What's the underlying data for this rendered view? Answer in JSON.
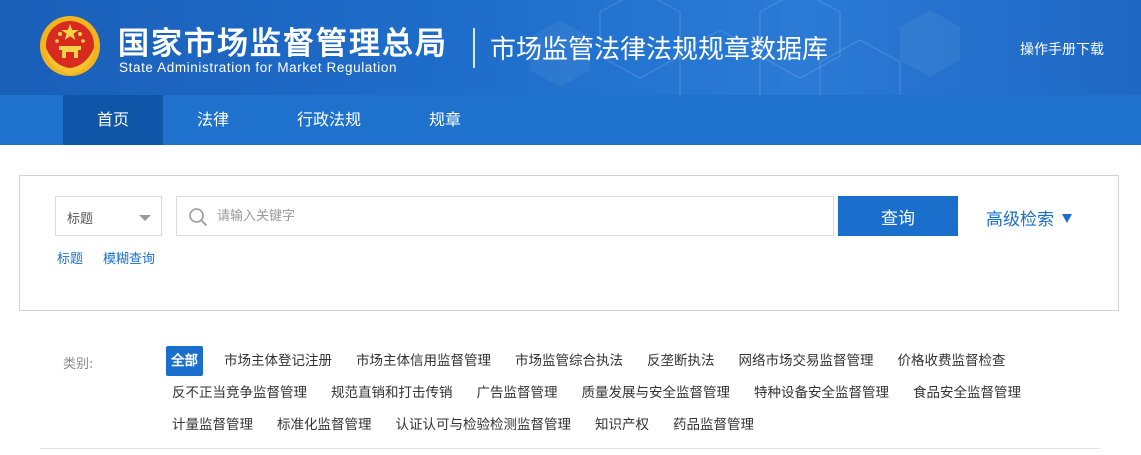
{
  "header": {
    "org_name_cn": "国家市场监督管理总局",
    "org_name_en": "State Administration for Market Regulation",
    "database_title": "市场监管法律法规规章数据库",
    "manual_download": "操作手册下载",
    "emblem_icon": "national-emblem-icon",
    "bg_color": "#1f6fcd"
  },
  "nav": {
    "items": [
      {
        "label": "首页",
        "active": true
      },
      {
        "label": "法律"
      },
      {
        "label": "行政法规"
      },
      {
        "label": "规章"
      }
    ]
  },
  "search": {
    "field_select_value": "标题",
    "placeholder": "请输入关键字",
    "query_button": "查询",
    "advanced_search": "高级检索",
    "modes": [
      "标题",
      "模糊查询"
    ],
    "accent_color": "#1a6fcc"
  },
  "categories": {
    "label": "类别:",
    "row1": [
      "全部",
      "市场主体登记注册",
      "市场主体信用监督管理",
      "市场监管综合执法",
      "反垄断执法",
      "网络市场交易监督管理",
      "价格收费监督检查"
    ],
    "row2": [
      "反不正当竞争监督管理",
      "规范直销和打击传销",
      "广告监督管理",
      "质量发展与安全监督管理",
      "特种设备安全监督管理",
      "食品安全监督管理"
    ],
    "row3": [
      "计量监督管理",
      "标准化监督管理",
      "认证认可与检验检测监督管理",
      "知识产权",
      "药品监督管理"
    ]
  }
}
